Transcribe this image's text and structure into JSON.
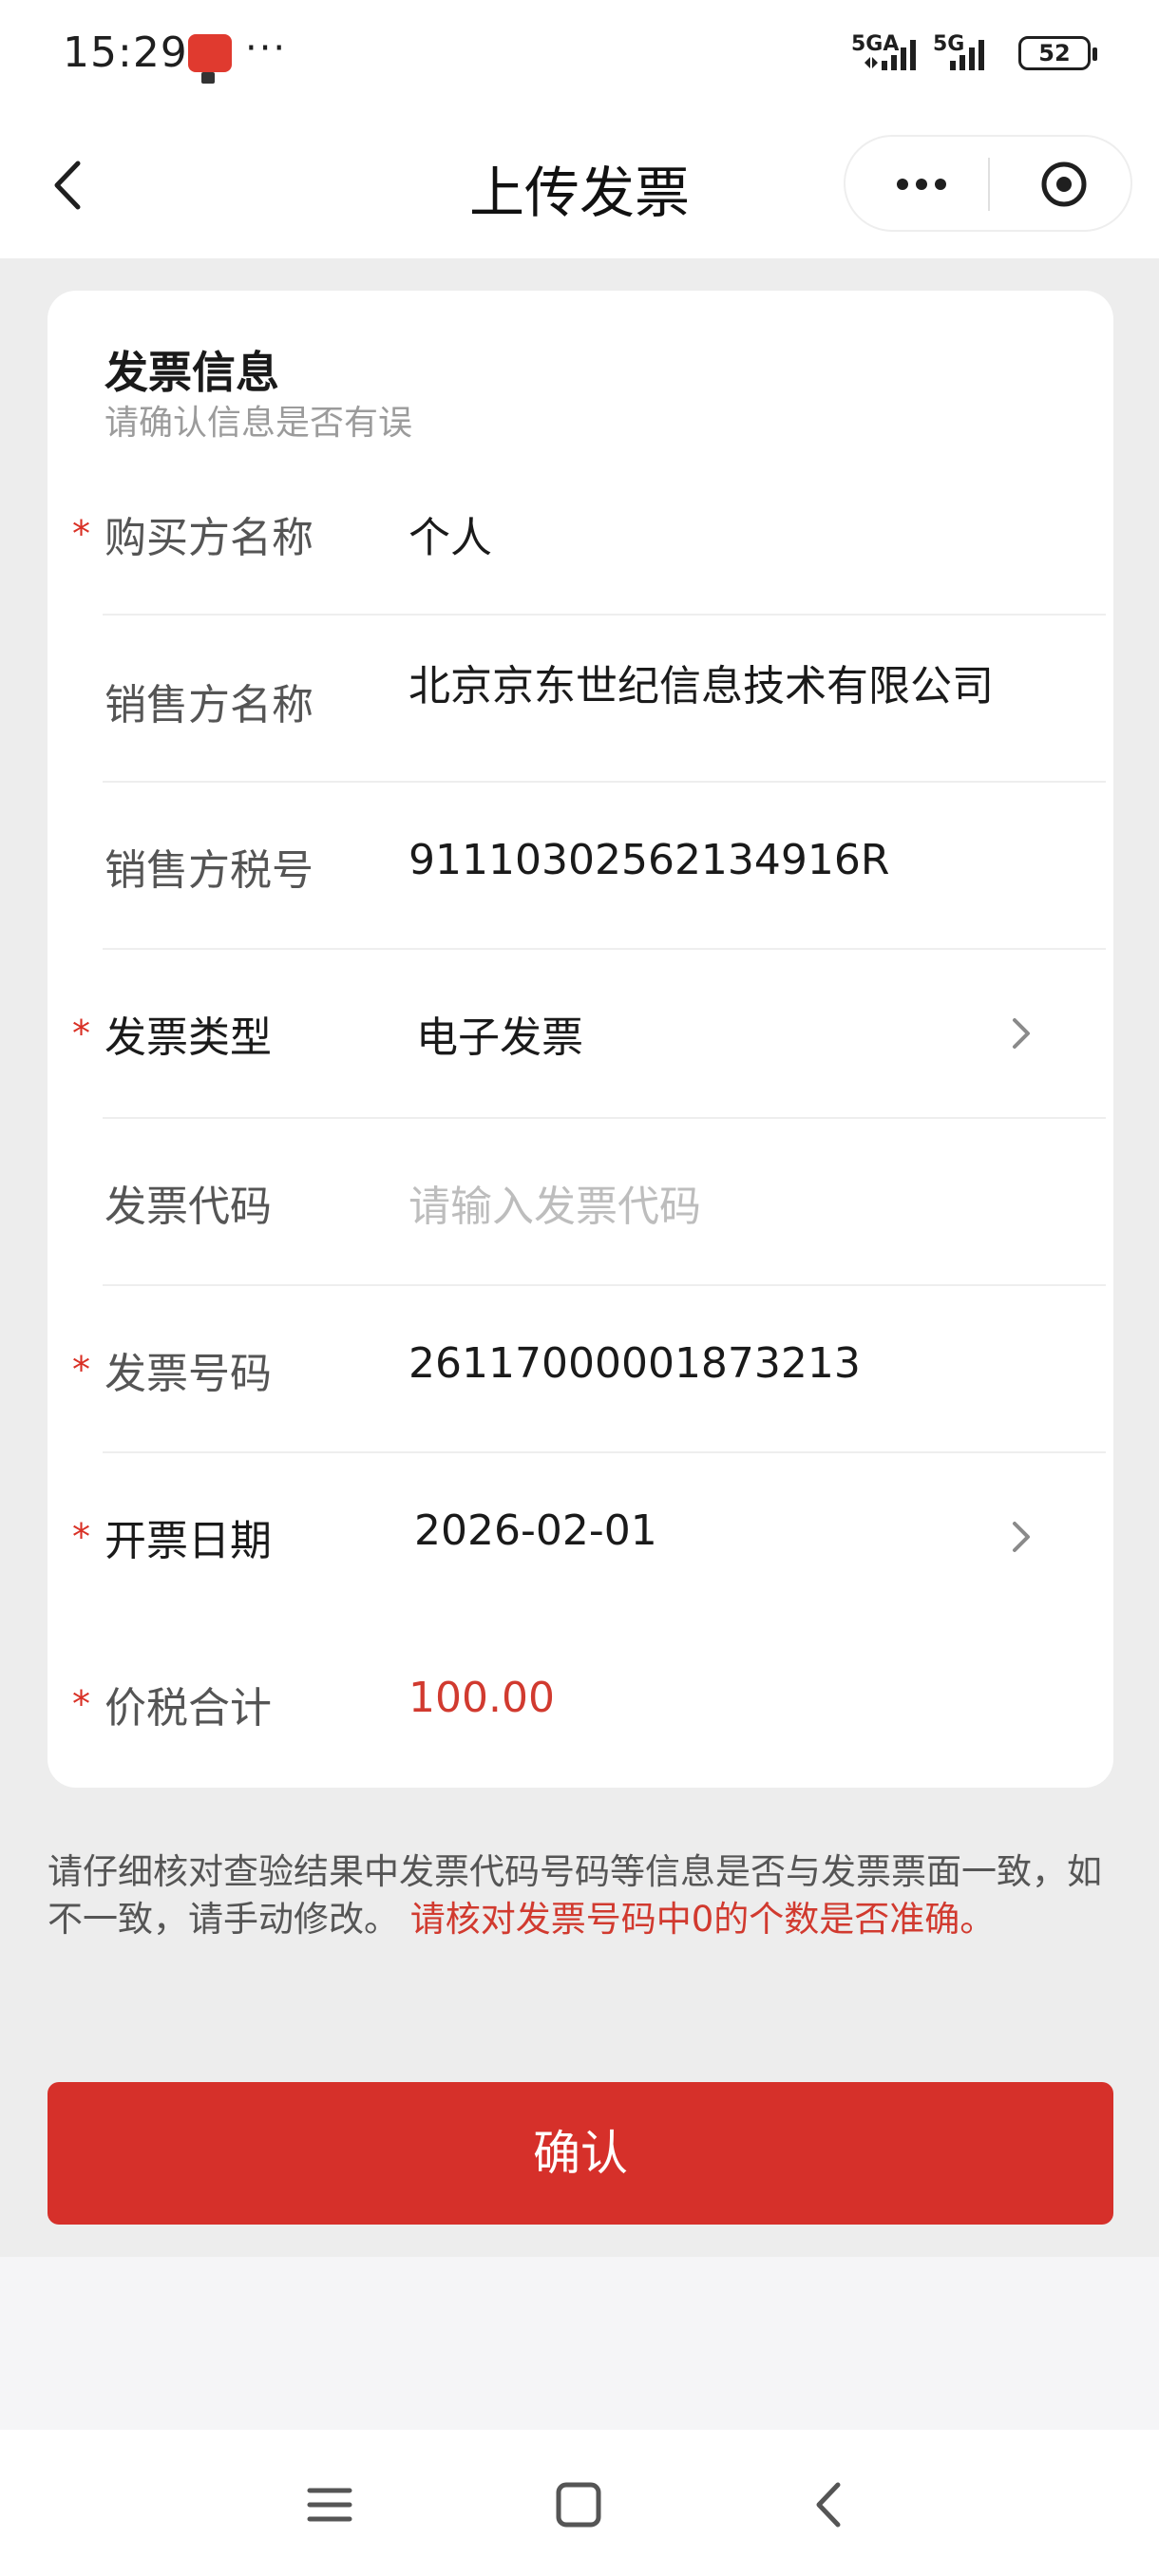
{
  "status_bar": {
    "time": "15:29",
    "more": "···",
    "network1": "5GA",
    "network2": "5G",
    "battery": "52"
  },
  "nav": {
    "title": "上传发票"
  },
  "card": {
    "title": "发票信息",
    "subtitle": "请确认信息是否有误",
    "fields": [
      {
        "label": "购买方名称",
        "value": "个人",
        "required": true
      },
      {
        "label": "销售方名称",
        "value": "北京京东世纪信息技术有限公司",
        "required": false
      },
      {
        "label": "销售方税号",
        "value": "91110302562134916R",
        "required": false
      },
      {
        "label": "发票类型",
        "value": "电子发票",
        "required": true
      },
      {
        "label": "发票代码",
        "placeholder": "请输入发票代码",
        "required": false
      },
      {
        "label": "发票号码",
        "value": "26117000001873213",
        "required": true
      },
      {
        "label": "开票日期",
        "value": "2026-02-01",
        "required": true
      },
      {
        "label": "价税合计",
        "value": "100.00",
        "required": true
      }
    ],
    "required_mark": "*"
  },
  "note": {
    "text": "请仔细核对查验结果中发票代码号码等信息是否与发票票面一致，如不一致，请手动修改。",
    "warning": "请核对发票号码中0的个数是否准确。"
  },
  "confirm_label": "确认",
  "colors": {
    "accent": "#d6302a",
    "warning_text": "#d13a2f",
    "background": "#ededed"
  }
}
